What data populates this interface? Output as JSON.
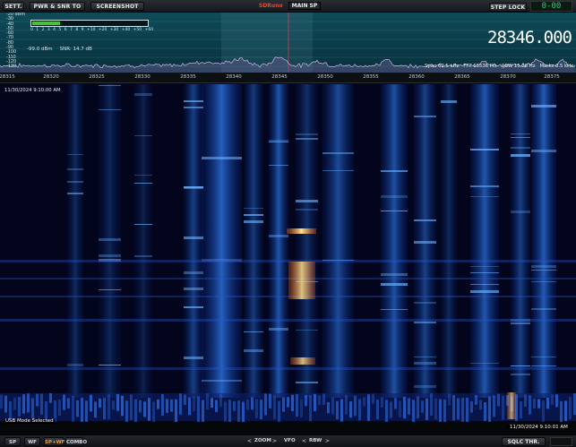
{
  "toolbar": {
    "sett": "SETT.",
    "pwr_snr_csv": "PWR & SNR TO CSV",
    "screenshot": "SCREENSHOT",
    "brand": "SDRuno",
    "mode": "MAIN SP",
    "step_lock": "STEP LOCK",
    "small_lcd": "0-00"
  },
  "spectrum": {
    "dbm_scale": [
      "-20 dBm",
      "-30",
      "-40",
      "-50",
      "-60",
      "-70",
      "-80",
      "-90",
      "-100",
      "-110",
      "-120",
      "-130"
    ],
    "meter_ticks": "0  1  2  3  4  5  6  7  8  9  +10 +20 +30 +40 +50 +60",
    "meter_level": 0.24,
    "power": "-99.0 dBm",
    "snr": "SNR: 14.7 dB",
    "frequency": "28346.000",
    "span": "Span 62.5 kHz",
    "fft": "FFT 65536 Pts",
    "rbw": "RBW 15.26 Hz",
    "marks": "Marks 0.5 kHz",
    "accent": "#0f4b58",
    "trace_color": "#c8b6e8"
  },
  "freq_scale": [
    "28315",
    "28320",
    "28325",
    "28330",
    "28335",
    "28340",
    "28345",
    "28350",
    "28355",
    "28360",
    "28365",
    "28370",
    "28375"
  ],
  "waterfall": {
    "time_top": "11/30/2024 9:10:00 AM",
    "status": "USB Mode Selected",
    "time_bottom": "11/30/2024 9:10:01 AM"
  },
  "bottom": {
    "sp": "SP",
    "wf": "WF",
    "sp_wf": "SP+WF",
    "combo": "COMBO",
    "zoom": "ZOOM",
    "vfo": "VFO",
    "rbw": "RBW",
    "sqlc_thr": "SQLC THR."
  }
}
